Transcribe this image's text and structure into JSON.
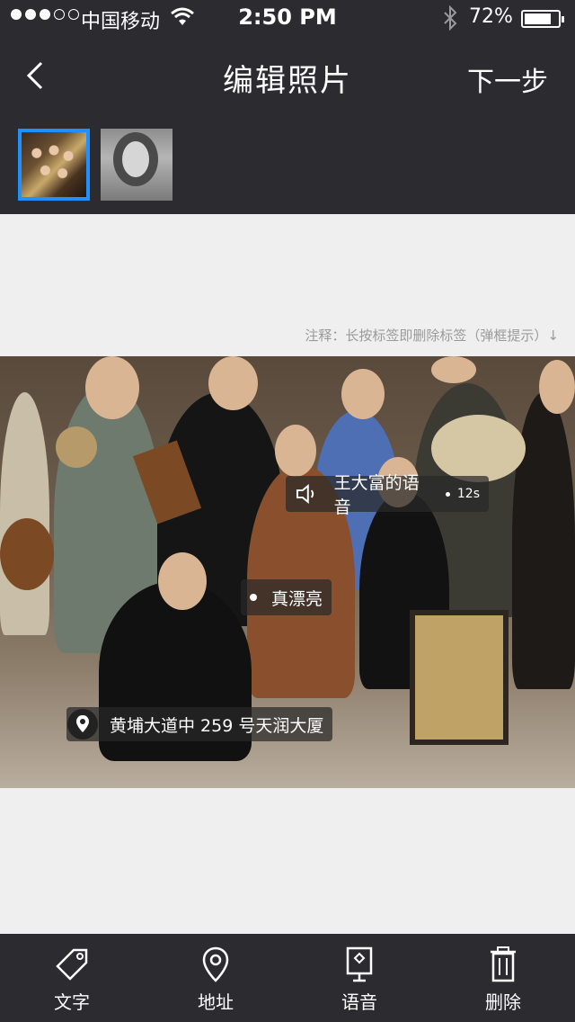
{
  "status": {
    "carrier": "中国移动",
    "time": "2:50 PM",
    "battery_pct": "72%"
  },
  "nav": {
    "back_icon": "chevron-left-icon",
    "title": "编辑照片",
    "next_label": "下一步"
  },
  "note": "注释：长按标签即删除标签（弹框提示）↓",
  "tags": {
    "voice": {
      "label": "王大富的语音",
      "duration": "12s"
    },
    "text": {
      "label": "真漂亮"
    },
    "location": {
      "label": "黄埔大道中 259 号天润大厦"
    }
  },
  "toolbar": {
    "text_label": "文字",
    "address_label": "地址",
    "voice_label": "语音",
    "delete_label": "删除"
  },
  "colors": {
    "bar_bg": "#2b2b30",
    "selected_border": "#1e90ff",
    "page_bg": "#efefef"
  }
}
